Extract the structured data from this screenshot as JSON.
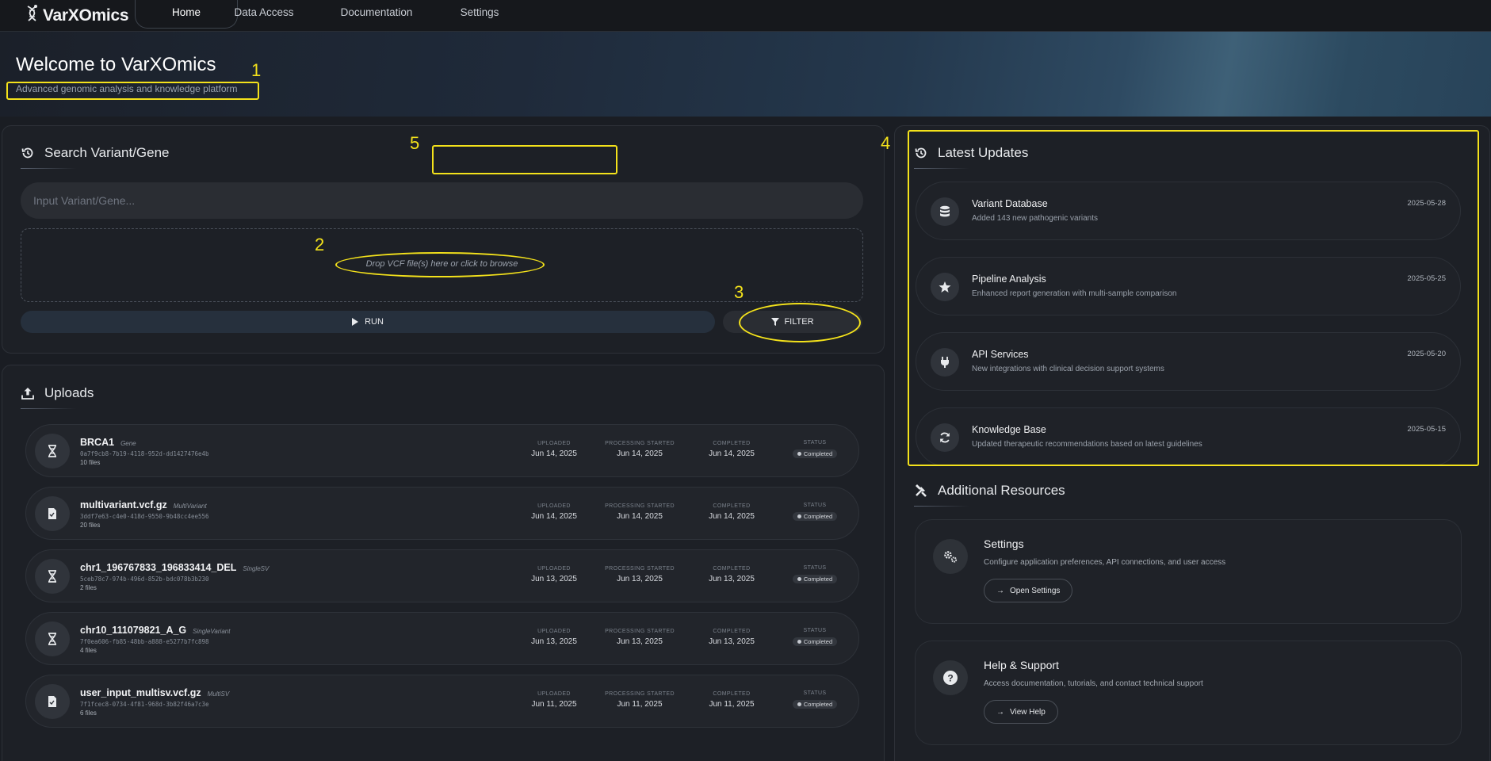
{
  "nav": {
    "logo": "VarXOmics",
    "items": [
      {
        "label": "Home",
        "active": true
      },
      {
        "label": "Data Access",
        "active": false
      },
      {
        "label": "Documentation",
        "active": false
      },
      {
        "label": "Settings",
        "active": false
      }
    ]
  },
  "hero": {
    "title": "Welcome to VarXOmics",
    "subtitle": "Advanced genomic analysis and knowledge platform"
  },
  "search": {
    "title": "Search Variant/Gene",
    "placeholder": "Input Variant/Gene...",
    "dropzone": "Drop VCF file(s) here or click to browse",
    "run_label": "RUN",
    "filter_label": "FILTER"
  },
  "uploads": {
    "title": "Uploads",
    "column_labels": {
      "uploaded": "UPLOADED",
      "processing": "PROCESSING STARTED",
      "completed": "COMPLETED",
      "status": "STATUS"
    },
    "items": [
      {
        "name": "BRCA1",
        "type": "Gene",
        "id": "0a7f9cb8-7b19-4118-952d-dd1427476e4b",
        "files": "10 files",
        "uploaded": "Jun 14, 2025",
        "processing": "Jun 14, 2025",
        "completed": "Jun 14, 2025",
        "status": "Completed",
        "icon": "dna-icon"
      },
      {
        "name": "multivariant.vcf.gz",
        "type": "MultiVariant",
        "id": "3ddf7e63-c4e0-418d-9550-9b48cc4ee556",
        "files": "20 files",
        "uploaded": "Jun 14, 2025",
        "processing": "Jun 14, 2025",
        "completed": "Jun 14, 2025",
        "status": "Completed",
        "icon": "file-icon"
      },
      {
        "name": "chr1_196767833_196833414_DEL",
        "type": "SingleSV",
        "id": "5ceb78c7-974b-496d-852b-bdc078b3b230",
        "files": "2 files",
        "uploaded": "Jun 13, 2025",
        "processing": "Jun 13, 2025",
        "completed": "Jun 13, 2025",
        "status": "Completed",
        "icon": "dna-icon"
      },
      {
        "name": "chr10_111079821_A_G",
        "type": "SingleVariant",
        "id": "7f0ea606-fb85-48bb-a888-e5277b7fc898",
        "files": "4 files",
        "uploaded": "Jun 13, 2025",
        "processing": "Jun 13, 2025",
        "completed": "Jun 13, 2025",
        "status": "Completed",
        "icon": "dna-icon"
      },
      {
        "name": "user_input_multisv.vcf.gz",
        "type": "MultiSV",
        "id": "7f1fcec8-0734-4f81-968d-3b82f46a7c3e",
        "files": "6 files",
        "uploaded": "Jun 11, 2025",
        "processing": "Jun 11, 2025",
        "completed": "Jun 11, 2025",
        "status": "Completed",
        "icon": "file-icon"
      }
    ]
  },
  "updates": {
    "title": "Latest Updates",
    "items": [
      {
        "title": "Variant Database",
        "desc": "Added 143 new pathogenic variants",
        "date": "2025-05-28",
        "icon": "database-icon"
      },
      {
        "title": "Pipeline Analysis",
        "desc": "Enhanced report generation with multi-sample comparison",
        "date": "2025-05-25",
        "icon": "star-icon"
      },
      {
        "title": "API Services",
        "desc": "New integrations with clinical decision support systems",
        "date": "2025-05-20",
        "icon": "plug-icon"
      },
      {
        "title": "Knowledge Base",
        "desc": "Updated therapeutic recommendations based on latest guidelines",
        "date": "2025-05-15",
        "icon": "sync-icon"
      }
    ]
  },
  "resources": {
    "title": "Additional Resources",
    "settings": {
      "title": "Settings",
      "desc": "Configure application preferences, API connections, and user access",
      "button": "Open Settings"
    },
    "help": {
      "title": "Help & Support",
      "desc": "Access documentation, tutorials, and contact technical support",
      "button": "View Help"
    }
  },
  "annotations": {
    "n1": "1",
    "n2": "2",
    "n3": "3",
    "n4": "4",
    "n5": "5"
  },
  "colors": {
    "highlight": "#f4e21b",
    "background": "#1a1d23",
    "panel": "#1d2026"
  }
}
